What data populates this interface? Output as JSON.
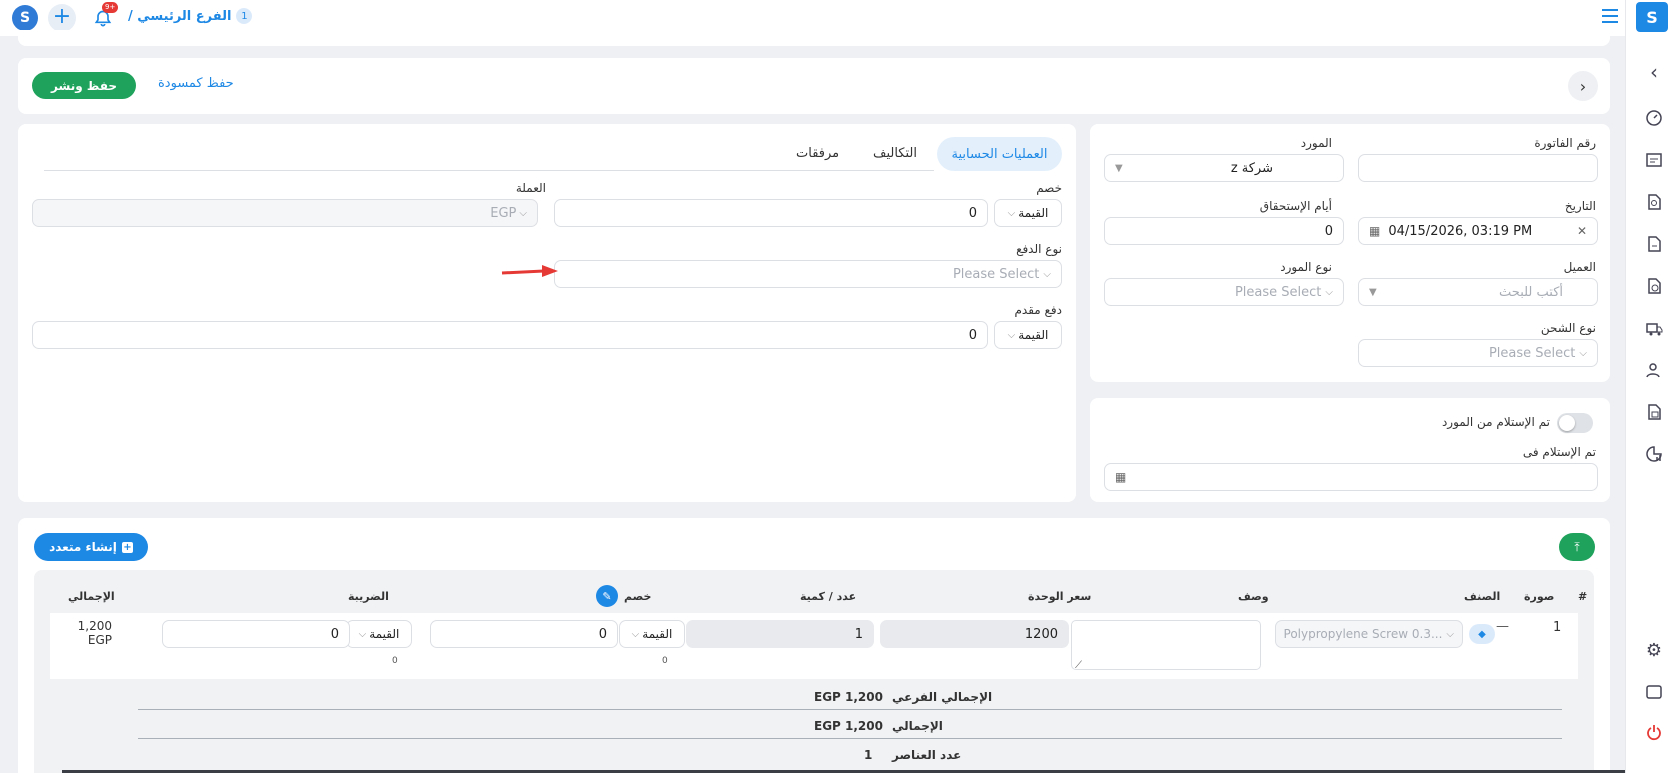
{
  "topbar": {
    "branch_number": "1",
    "branch_name": "الفرع الرئيسي /",
    "notif_count": "9+"
  },
  "actions": {
    "draft": "حفظ كمسودة",
    "publish": "حفظ ونشر"
  },
  "invoice": {
    "invoice_no_label": "رقم الفاتورة",
    "invoice_no_value": "",
    "supplier_label": "المورد",
    "supplier_value": "شركة z",
    "date_label": "التاريخ",
    "date_value": "04/15/2026, 03:19 PM",
    "due_days_label": "أيام الإستحقاق",
    "due_days_value": "0",
    "customer_label": "العميل",
    "customer_placeholder": "أكتب للبحث",
    "supplier_type_label": "نوع المورد",
    "supplier_type_placeholder": "Please Select",
    "shipping_type_label": "نوع الشحن",
    "shipping_type_placeholder": "Please Select"
  },
  "receipt": {
    "received_toggle_label": "تم الإستلام من المورد",
    "received_at_label": "تم الإستلام فى",
    "received_toggle_on": false
  },
  "tabs": [
    {
      "label": "العمليات الحسابية",
      "active": true
    },
    {
      "label": "التكاليف",
      "active": false
    },
    {
      "label": "مرفقات",
      "active": false
    }
  ],
  "accounting": {
    "discount_label": "خصم",
    "discount_mode": "القيمة",
    "discount_value": "0",
    "currency_label": "العملة",
    "currency_value": "EGP",
    "payment_type_label": "نوع الدفع",
    "payment_type_placeholder": "Please Select",
    "advance_label": "دفع مقدم",
    "advance_mode": "القيمة",
    "advance_value": "0"
  },
  "items": {
    "create_multi": "إنشاء متعدد",
    "headers": {
      "num": "#",
      "image": "صورة",
      "item": "الصنف",
      "desc": "وصف",
      "unit_price": "سعر الوحدة",
      "qty": "عدد / كمية",
      "discount": "خصم",
      "tax": "الضريبة",
      "total": "الإجمالي"
    },
    "rows": [
      {
        "num": "1",
        "image": "—",
        "item": "Polypropylene Screw 0.3...",
        "desc": "",
        "unit_price": "1200",
        "qty": "1",
        "discount_mode": "القيمة",
        "discount": "0",
        "discount_sub": "0",
        "tax_mode": "القيمة",
        "tax": "0",
        "tax_sub": "0",
        "total_amount": "1,200",
        "total_currency": "EGP"
      }
    ]
  },
  "summary": {
    "subtotal_label": "الإجمالي الفرعي",
    "subtotal": "EGP 1,200",
    "total_label": "الإجمالي",
    "total": "EGP 1,200",
    "count_label": "عدد العناصر",
    "count": "1"
  },
  "colors": {
    "primary": "#1e88e5",
    "success": "#1fa35c",
    "danger": "#e53935",
    "tab_active_bg": "#e3f0fc"
  }
}
